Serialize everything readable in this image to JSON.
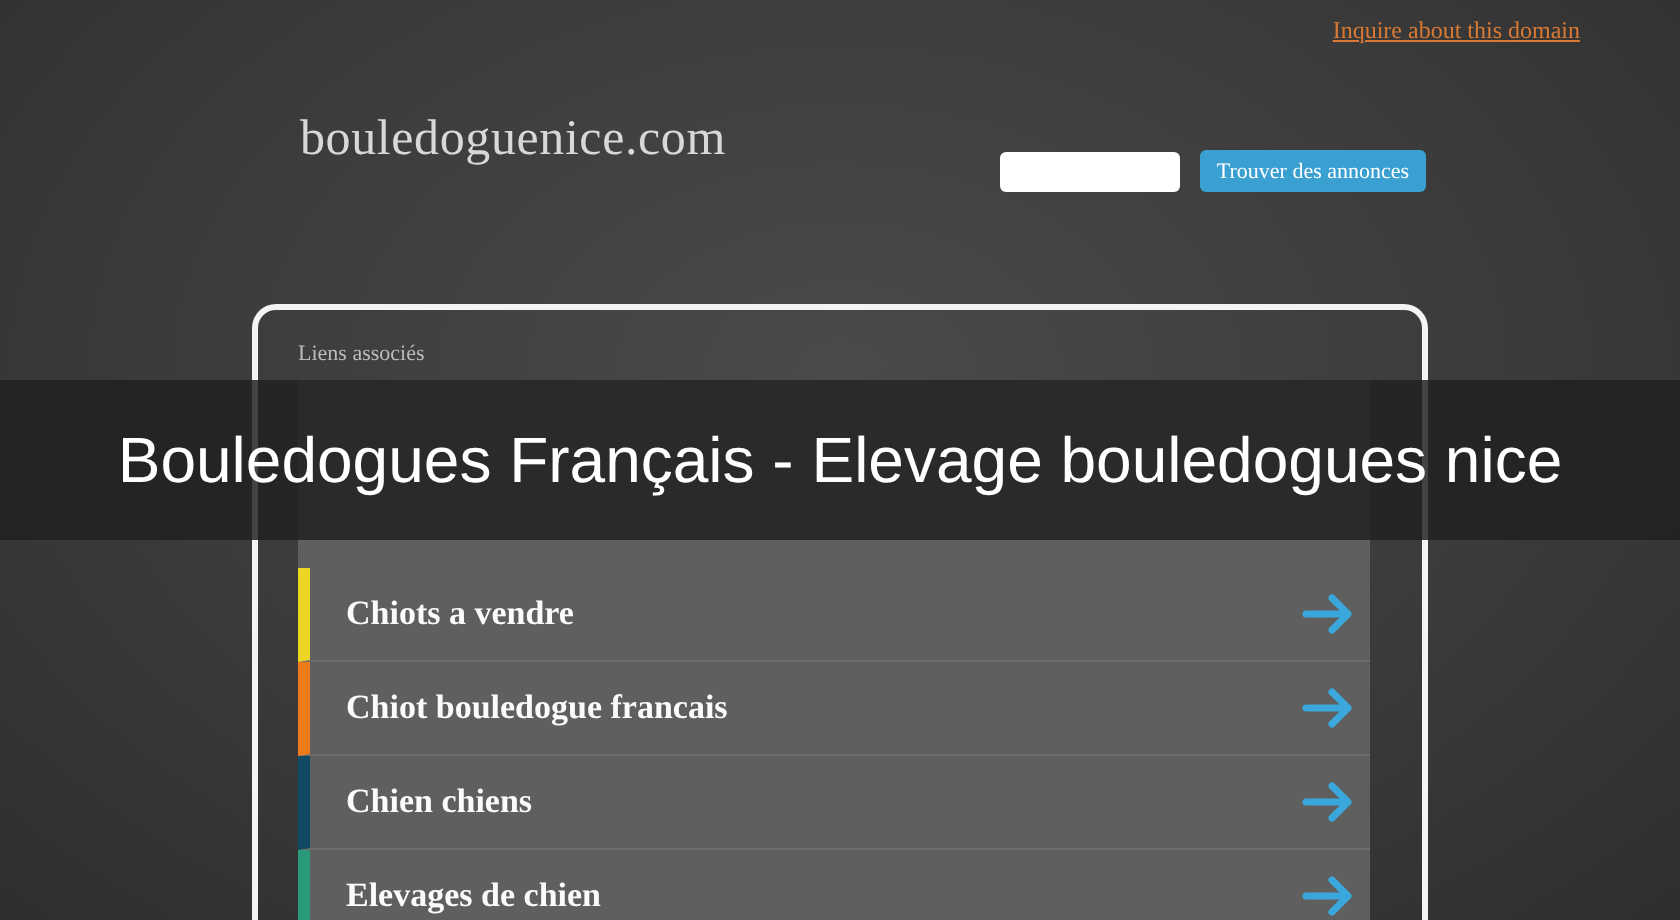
{
  "header": {
    "inquire_link": "Inquire about this domain",
    "logo": "bouledoguenice.com",
    "search": {
      "button": "Trouver des annonces"
    }
  },
  "links_panel": {
    "heading": "Liens associés",
    "items": [
      {
        "label": "Chiots a vendre",
        "color": "#ecd624"
      },
      {
        "label": "Chiot bouledogue francais",
        "color": "#ef7a1c"
      },
      {
        "label": "Chien chiens",
        "color": "#0f4a62"
      },
      {
        "label": "Elevages de chien",
        "color": "#2a9a7a"
      }
    ]
  },
  "title_banner": {
    "text": "Bouledogues Français - Elevage bouledogues nice"
  }
}
